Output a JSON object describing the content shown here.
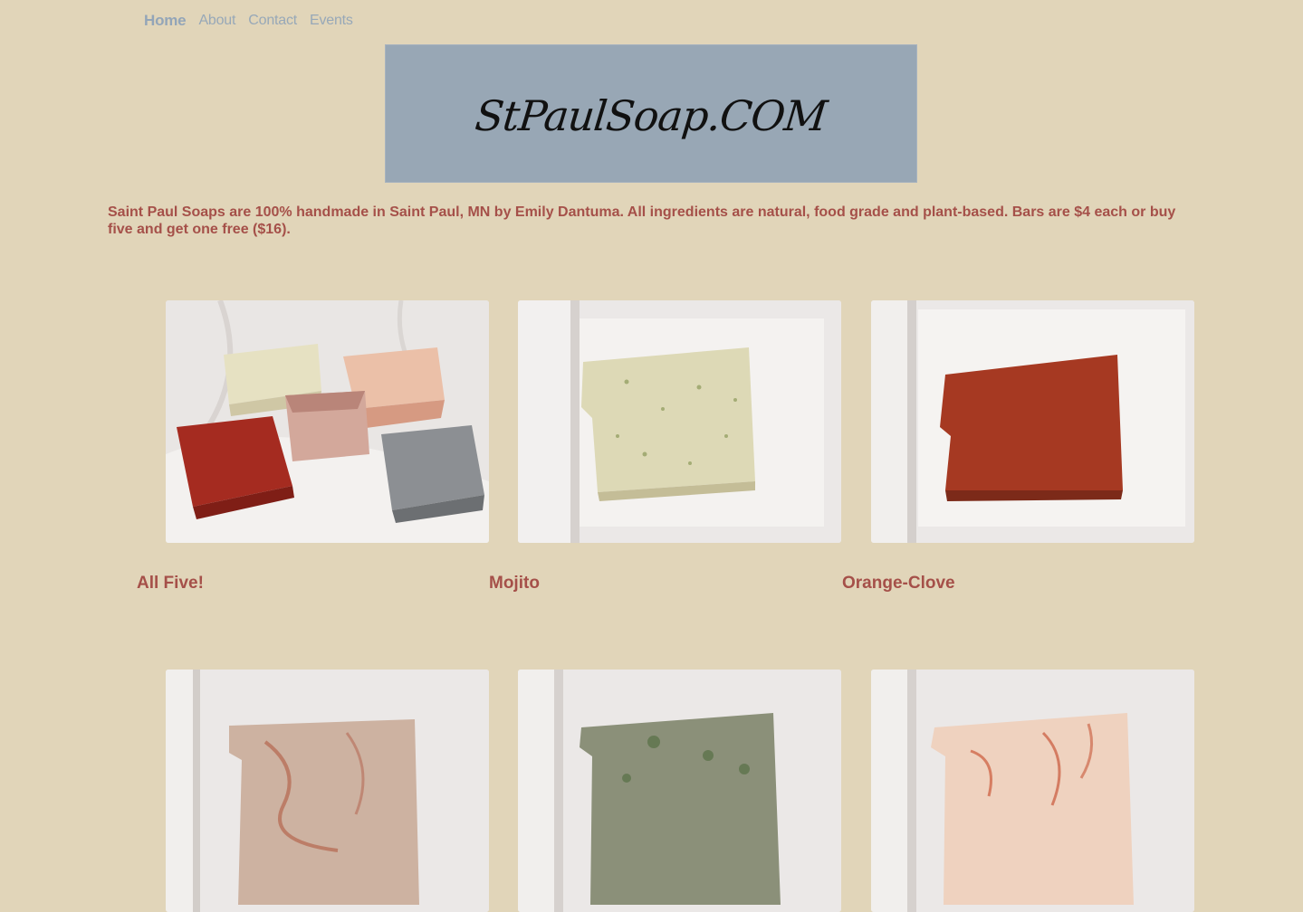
{
  "nav": {
    "items": [
      {
        "label": "Home",
        "active": true
      },
      {
        "label": "About"
      },
      {
        "label": "Contact"
      },
      {
        "label": "Events"
      }
    ]
  },
  "banner": {
    "title": "StPaulSoap.COM"
  },
  "intro": {
    "text": "Saint Paul Soaps are 100% handmade in Saint Paul, MN by Emily Dantuma. All ingredients are natural, food grade and plant-based. Bars are $4 each or buy five and get one free ($16)."
  },
  "products": [
    {
      "label": "All Five!"
    },
    {
      "label": "Mojito"
    },
    {
      "label": "Orange-Clove"
    },
    {
      "label": ""
    },
    {
      "label": ""
    },
    {
      "label": ""
    }
  ],
  "colors": {
    "background": "#e1d5b9",
    "banner": "#98a7b5",
    "accent_text": "#a55049",
    "nav": "#97a8b8"
  }
}
